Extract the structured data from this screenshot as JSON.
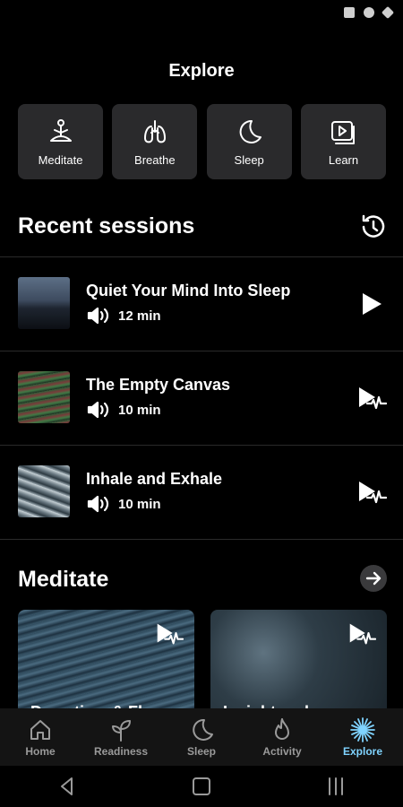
{
  "header": {
    "title": "Explore"
  },
  "categories": [
    {
      "label": "Meditate",
      "icon": "meditate-icon"
    },
    {
      "label": "Breathe",
      "icon": "lungs-icon"
    },
    {
      "label": "Sleep",
      "icon": "moon-icon"
    },
    {
      "label": "Learn",
      "icon": "play-video-icon"
    }
  ],
  "recent": {
    "title": "Recent sessions",
    "items": [
      {
        "title": "Quiet Your Mind Into Sleep",
        "duration": "12 min"
      },
      {
        "title": "The Empty Canvas",
        "duration": "10 min"
      },
      {
        "title": "Inhale and Exhale",
        "duration": "10 min"
      }
    ]
  },
  "meditate": {
    "title": "Meditate",
    "cards": [
      {
        "title": "Downtime & Fla..."
      },
      {
        "title": "Insight and..."
      }
    ]
  },
  "nav": {
    "items": [
      {
        "label": "Home"
      },
      {
        "label": "Readiness"
      },
      {
        "label": "Sleep"
      },
      {
        "label": "Activity"
      },
      {
        "label": "Explore"
      }
    ]
  },
  "colors": {
    "accent": "#7fd3ff",
    "tile": "#2a2a2c",
    "background": "#000000"
  }
}
